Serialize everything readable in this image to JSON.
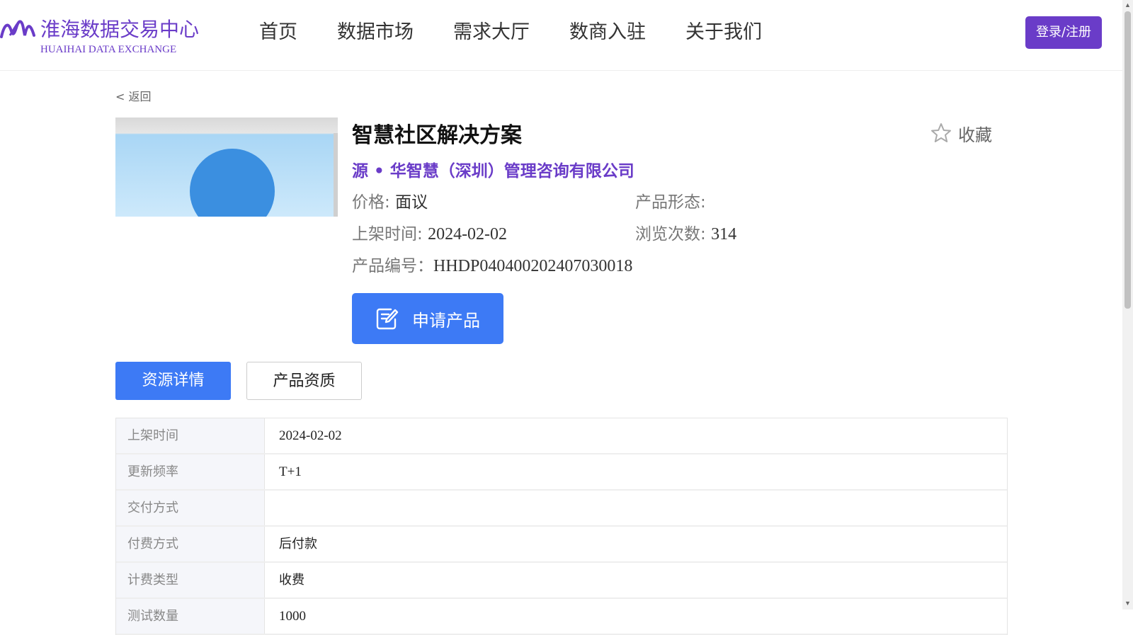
{
  "header": {
    "logo_cn": "淮海数据交易中心",
    "logo_en": "HUAIHAI DATA EXCHANGE",
    "nav": [
      "首页",
      "数据市场",
      "需求大厅",
      "数商入驻",
      "关于我们"
    ],
    "login_label": "登录/注册",
    "brand_color": "#6a3cc8"
  },
  "back_label": "< 返回",
  "product": {
    "title": "智慧社区解决方案",
    "favorite_label": "收藏",
    "provider": "源 • 华智慧（深圳）管理咨询有限公司",
    "price_label": "价格:",
    "price_value": "面议",
    "form_label": "产品形态:",
    "form_value": "",
    "listed_label": "上架时间:",
    "listed_value": "2024-02-02",
    "views_label": "浏览次数:",
    "views_value": "314",
    "code_label": "产品编号：",
    "code_value": "HHDP040400202407030018",
    "apply_label": "申请产品",
    "accent_color": "#3d7af5"
  },
  "tabs": [
    "资源详情",
    "产品资质"
  ],
  "details": [
    {
      "key": "上架时间",
      "value": "2024-02-02"
    },
    {
      "key": "更新频率",
      "value": "T+1"
    },
    {
      "key": "交付方式",
      "value": ""
    },
    {
      "key": "付费方式",
      "value": "后付款"
    },
    {
      "key": "计费类型",
      "value": "收费"
    },
    {
      "key": "测试数量",
      "value": "1000"
    }
  ],
  "icons": [
    "logo-mark-icon",
    "star-icon",
    "edit-icon"
  ]
}
